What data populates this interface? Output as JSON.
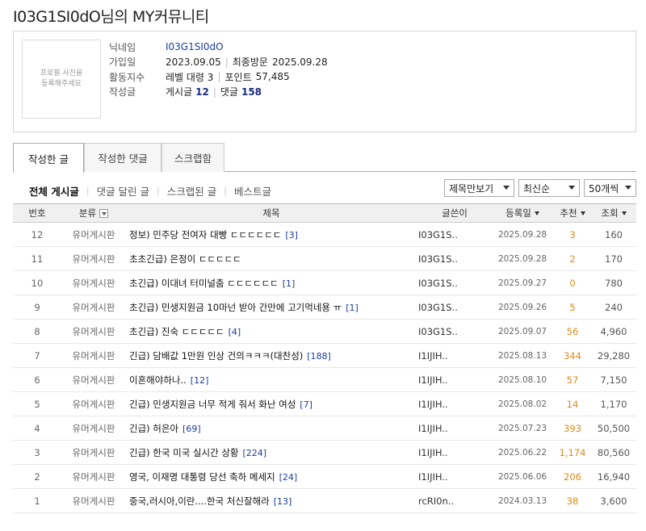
{
  "page": {
    "title": "I03G1SI0dO님의 MY커뮤니티"
  },
  "profile": {
    "photo_text_1": "프로필 사진을",
    "photo_text_2": "등록해주세요",
    "nickname_label": "닉네임",
    "nickname": "I03G1SI0dO",
    "joined_label": "가입일",
    "joined": "2023.09.05",
    "last_visit_label": "최종방문",
    "last_visit": "2025.09.28",
    "activity_label": "활동지수",
    "level": "레벨 대령 3",
    "points_label": "포인트",
    "points": "57,485",
    "posts_label": "작성글",
    "post_count_label": "게시글",
    "post_count": "12",
    "reply_count_label": "댓글",
    "reply_count": "158"
  },
  "tabs": [
    "작성한 글",
    "작성한 댓글",
    "스크랩함"
  ],
  "subnav": [
    "전체 게시글",
    "댓글 달린 글",
    "스크랩된 글",
    "베스트글"
  ],
  "selects": {
    "view": "제목만보기",
    "sort": "최신순",
    "count": "50개씩"
  },
  "table": {
    "headers": {
      "num": "번호",
      "category": "분류",
      "title": "제목",
      "writer": "글쓴이",
      "date": "등록일",
      "recommend": "추천",
      "views": "조회"
    },
    "rows": [
      {
        "num": "12",
        "category": "유머게시판",
        "title": "정보) 민주당 전여자 대빵 ㄷㄷㄷㄷㄷㄷ",
        "comments": "[3]",
        "writer": "I03G1S..",
        "date": "2025.09.28",
        "recommend": "3",
        "views": "160"
      },
      {
        "num": "11",
        "category": "유머게시판",
        "title": "초초긴급) 은정이 ㄷㄷㄷㄷㄷ",
        "comments": "",
        "writer": "I03G1S..",
        "date": "2025.09.28",
        "recommend": "2",
        "views": "170"
      },
      {
        "num": "10",
        "category": "유머게시판",
        "title": "초긴급) 이대녀 터미널춤 ㄷㄷㄷㄷㄷㄷ",
        "comments": "[1]",
        "writer": "I03G1S..",
        "date": "2025.09.27",
        "recommend": "0",
        "views": "780"
      },
      {
        "num": "9",
        "category": "유머게시판",
        "title": "초긴급) 민생지원금 10마넌 받아 간만에 고기먹네용 ㅠ",
        "comments": "[1]",
        "writer": "I03G1S..",
        "date": "2025.09.26",
        "recommend": "5",
        "views": "240"
      },
      {
        "num": "8",
        "category": "유머게시판",
        "title": "초긴급) 진숙 ㄷㄷㄷㄷㄷ",
        "comments": "[4]",
        "writer": "I03G1S..",
        "date": "2025.09.07",
        "recommend": "56",
        "views": "4,960"
      },
      {
        "num": "7",
        "category": "유머게시판",
        "title": "긴급) 담배값 1만원 인상 건의ㅋㅋㅋ(대찬성)",
        "comments": "[188]",
        "writer": "I1IJIH..",
        "date": "2025.08.13",
        "recommend": "344",
        "views": "29,280"
      },
      {
        "num": "6",
        "category": "유머게시판",
        "title": "이혼해야하나..",
        "comments": "[12]",
        "writer": "I1IJIH..",
        "date": "2025.08.10",
        "recommend": "57",
        "views": "7,150"
      },
      {
        "num": "5",
        "category": "유머게시판",
        "title": "긴급) 민생지원금 너무 적게 줘서 화난 여성",
        "comments": "[7]",
        "writer": "I1IJIH..",
        "date": "2025.08.02",
        "recommend": "14",
        "views": "1,170"
      },
      {
        "num": "4",
        "category": "유머게시판",
        "title": "긴급) 허은아",
        "comments": "[69]",
        "writer": "I1IJIH..",
        "date": "2025.07.23",
        "recommend": "393",
        "views": "50,500"
      },
      {
        "num": "3",
        "category": "유머게시판",
        "title": "긴급) 한국 미국 실시간 상황",
        "comments": "[224]",
        "writer": "I1IJIH..",
        "date": "2025.06.22",
        "recommend": "1,174",
        "views": "80,560"
      },
      {
        "num": "2",
        "category": "유머게시판",
        "title": "영국, 이재명 대통령 당선 축하 메세지",
        "comments": "[24]",
        "writer": "I1IJIH..",
        "date": "2025.06.06",
        "recommend": "206",
        "views": "16,940"
      },
      {
        "num": "1",
        "category": "유머게시판",
        "title": "중국,러시아,이란....한국 처신잘해라",
        "comments": "[13]",
        "writer": "rcRI0n..",
        "date": "2024.03.13",
        "recommend": "38",
        "views": "3,600"
      }
    ]
  }
}
